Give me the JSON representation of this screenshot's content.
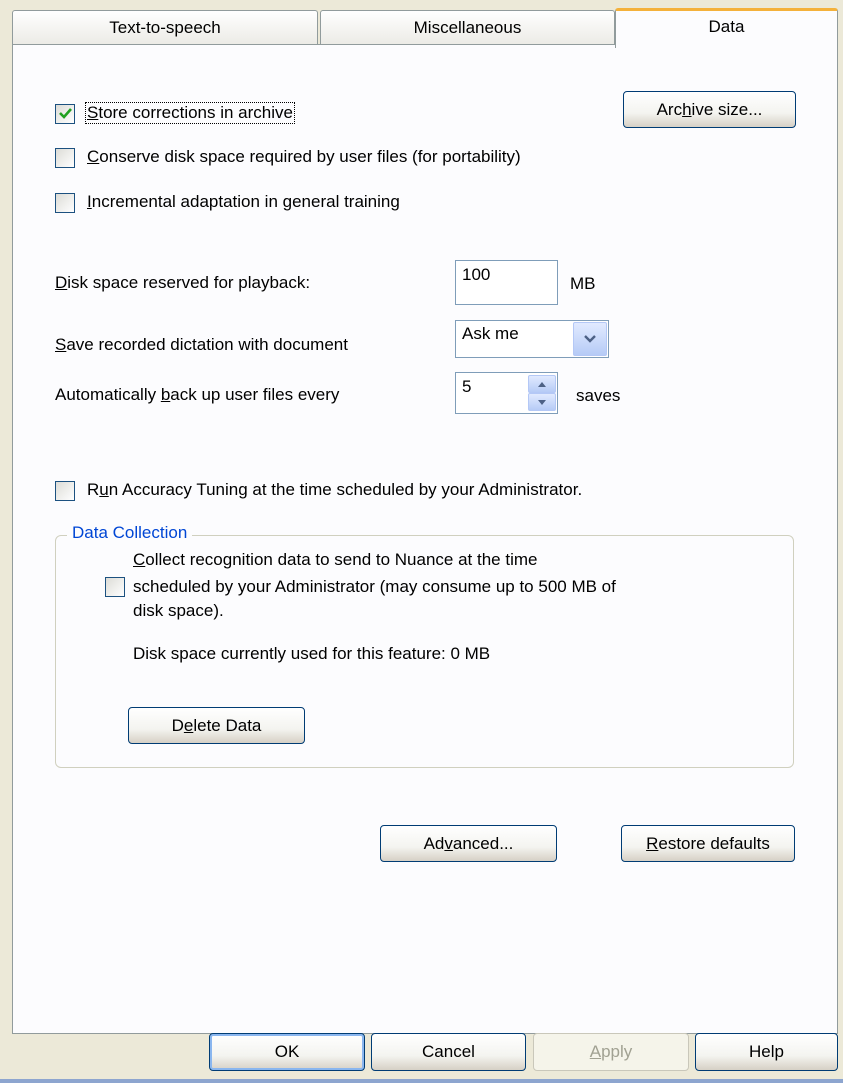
{
  "tabs": [
    {
      "label": "Text-to-speech"
    },
    {
      "label": "Miscellaneous"
    },
    {
      "label": "Data",
      "active": true
    }
  ],
  "options": {
    "store_corrections": {
      "before": "",
      "mnemonic": "S",
      "after": "tore corrections in archive",
      "checked": true
    },
    "conserve_disk": {
      "before": "",
      "mnemonic": "C",
      "after": "onserve disk space required by user files (for portability)",
      "checked": false
    },
    "incremental": {
      "before": "",
      "mnemonic": "I",
      "after": "ncremental adaptation in general training",
      "checked": false
    },
    "accuracy_tuning": {
      "before": "R",
      "mnemonic": "u",
      "after": "n Accuracy Tuning at the time scheduled by your Administrator.",
      "checked": false
    }
  },
  "archive_button": {
    "before": "Arc",
    "mnemonic": "h",
    "after": "ive size..."
  },
  "playback": {
    "label_mnemonic": "D",
    "label_rest": "isk space reserved for playback:",
    "value": "100",
    "unit": "MB"
  },
  "save_recorded": {
    "label_mnemonic": "S",
    "label_rest": "ave recorded dictation with document",
    "selected": "Ask me"
  },
  "backup": {
    "label_before": "Automatically ",
    "label_mnemonic": "b",
    "label_after": "ack up user files every",
    "value": "5",
    "unit": "saves"
  },
  "data_collection": {
    "title": "Data Collection",
    "collect_line1_mnemonic": "C",
    "collect_line1_rest": "ollect recognition data to send to Nuance at the time",
    "collect_line2": "scheduled by your Administrator (may consume up to 500 MB of",
    "collect_line3": "disk space).",
    "collect_checked": false,
    "disk_used": "Disk space currently used for this feature: 0 MB",
    "delete_before": "D",
    "delete_mnemonic": "e",
    "delete_after": "lete Data"
  },
  "advanced_button": {
    "before": "Ad",
    "mnemonic": "v",
    "after": "anced..."
  },
  "restore_button": {
    "mnemonic": "R",
    "after": "estore defaults"
  },
  "dialog_buttons": {
    "ok": "OK",
    "cancel": "Cancel",
    "apply_mnemonic": "A",
    "apply_rest": "pply",
    "help": "Help"
  },
  "colors": {
    "checkmark": "#21a121",
    "accent_tab": "#f4b13b",
    "group_title": "#0046d5"
  }
}
